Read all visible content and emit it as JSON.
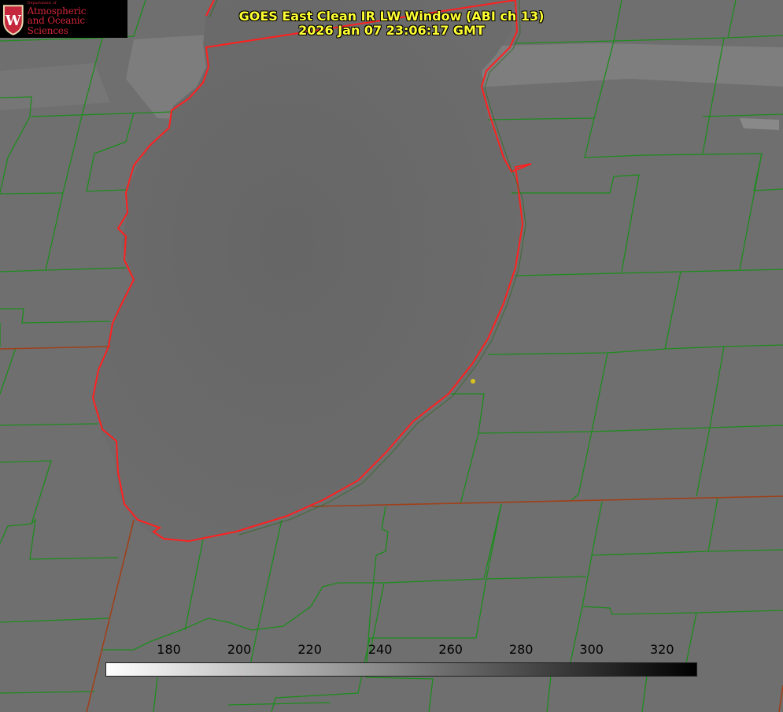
{
  "title": {
    "line1": "GOES East Clean IR LW Window (ABI ch 13)",
    "line2": "2026 Jan 07 23:06:17 GMT"
  },
  "logo": {
    "shield_letter": "W",
    "dept": "Department of",
    "line1": "Atmospheric",
    "line2": "and Oceanic Sciences"
  },
  "colorbar": {
    "min": 162,
    "max": 330,
    "ticks": [
      "180",
      "200",
      "220",
      "240",
      "260",
      "280",
      "300",
      "320"
    ],
    "color_low": "#ffffff",
    "color_high": "#000000"
  },
  "colors": {
    "county_lines": "#1e8c1e",
    "coastline": "#ff2020",
    "title_text": "#ffff33",
    "marker": "#d8c020"
  }
}
